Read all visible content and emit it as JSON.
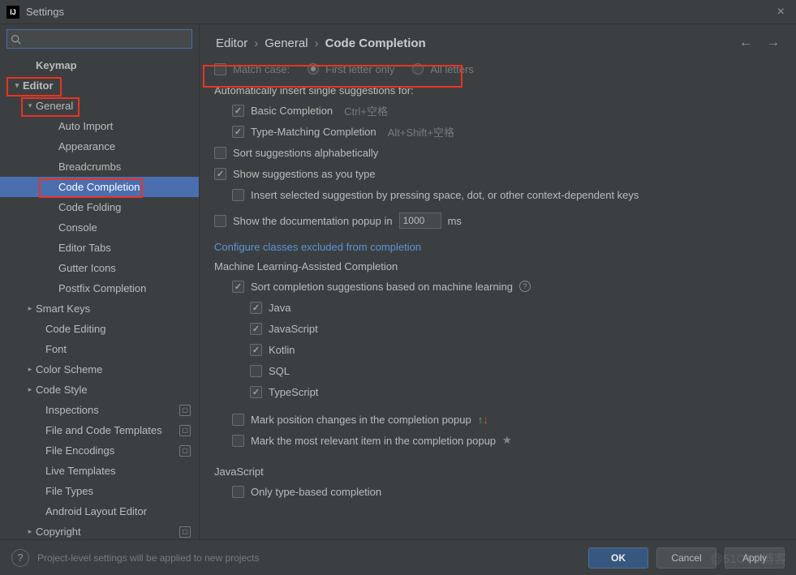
{
  "title": "Settings",
  "search": {
    "placeholder": ""
  },
  "sidebar": {
    "items": [
      {
        "label": "Keymap",
        "indent": 30,
        "chev": "",
        "bold": true
      },
      {
        "label": "Editor",
        "indent": 14,
        "chev": "▾",
        "bold": true
      },
      {
        "label": "General",
        "indent": 30,
        "chev": "▾"
      },
      {
        "label": "Auto Import",
        "indent": 58
      },
      {
        "label": "Appearance",
        "indent": 58
      },
      {
        "label": "Breadcrumbs",
        "indent": 58
      },
      {
        "label": "Code Completion",
        "indent": 58,
        "selected": true
      },
      {
        "label": "Code Folding",
        "indent": 58
      },
      {
        "label": "Console",
        "indent": 58
      },
      {
        "label": "Editor Tabs",
        "indent": 58
      },
      {
        "label": "Gutter Icons",
        "indent": 58
      },
      {
        "label": "Postfix Completion",
        "indent": 58
      },
      {
        "label": "Smart Keys",
        "indent": 30,
        "chev": "▸"
      },
      {
        "label": "Code Editing",
        "indent": 42
      },
      {
        "label": "Font",
        "indent": 42
      },
      {
        "label": "Color Scheme",
        "indent": 30,
        "chev": "▸"
      },
      {
        "label": "Code Style",
        "indent": 30,
        "chev": "▸"
      },
      {
        "label": "Inspections",
        "indent": 42,
        "badge": true
      },
      {
        "label": "File and Code Templates",
        "indent": 42,
        "badge": true
      },
      {
        "label": "File Encodings",
        "indent": 42,
        "badge": true
      },
      {
        "label": "Live Templates",
        "indent": 42
      },
      {
        "label": "File Types",
        "indent": 42
      },
      {
        "label": "Android Layout Editor",
        "indent": 42
      },
      {
        "label": "Copyright",
        "indent": 30,
        "chev": "▸",
        "badge": true
      }
    ]
  },
  "breadcrumb": {
    "a": "Editor",
    "b": "General",
    "c": "Code Completion"
  },
  "panel": {
    "match_case_label": "Match case:",
    "radio_first": "First letter only",
    "radio_all": "All letters",
    "auto_insert_label": "Automatically insert single suggestions for:",
    "basic_label": "Basic Completion",
    "basic_shortcut": "Ctrl+空格",
    "type_label": "Type-Matching Completion",
    "type_shortcut": "Alt+Shift+空格",
    "sort_alpha": "Sort suggestions alphabetically",
    "show_type": "Show suggestions as you type",
    "insert_selected": "Insert selected suggestion by pressing space, dot, or other context-dependent keys",
    "show_doc": "Show the documentation popup in",
    "doc_ms_value": "1000",
    "ms": "ms",
    "configure_link": "Configure classes excluded from completion",
    "ml_heading": "Machine Learning-Assisted Completion",
    "ml_sort": "Sort completion suggestions based on machine learning",
    "java": "Java",
    "js": "JavaScript",
    "kotlin": "Kotlin",
    "sql": "SQL",
    "ts": "TypeScript",
    "mark_pos": "Mark position changes in the completion popup",
    "mark_rel": "Mark the most relevant item in the completion popup",
    "js_heading": "JavaScript",
    "only_type": "Only type-based completion"
  },
  "footer": {
    "hint": "Project-level settings will be applied to new projects",
    "ok": "OK",
    "cancel": "Cancel",
    "apply": "Apply"
  },
  "watermark": "@51CTO博客"
}
